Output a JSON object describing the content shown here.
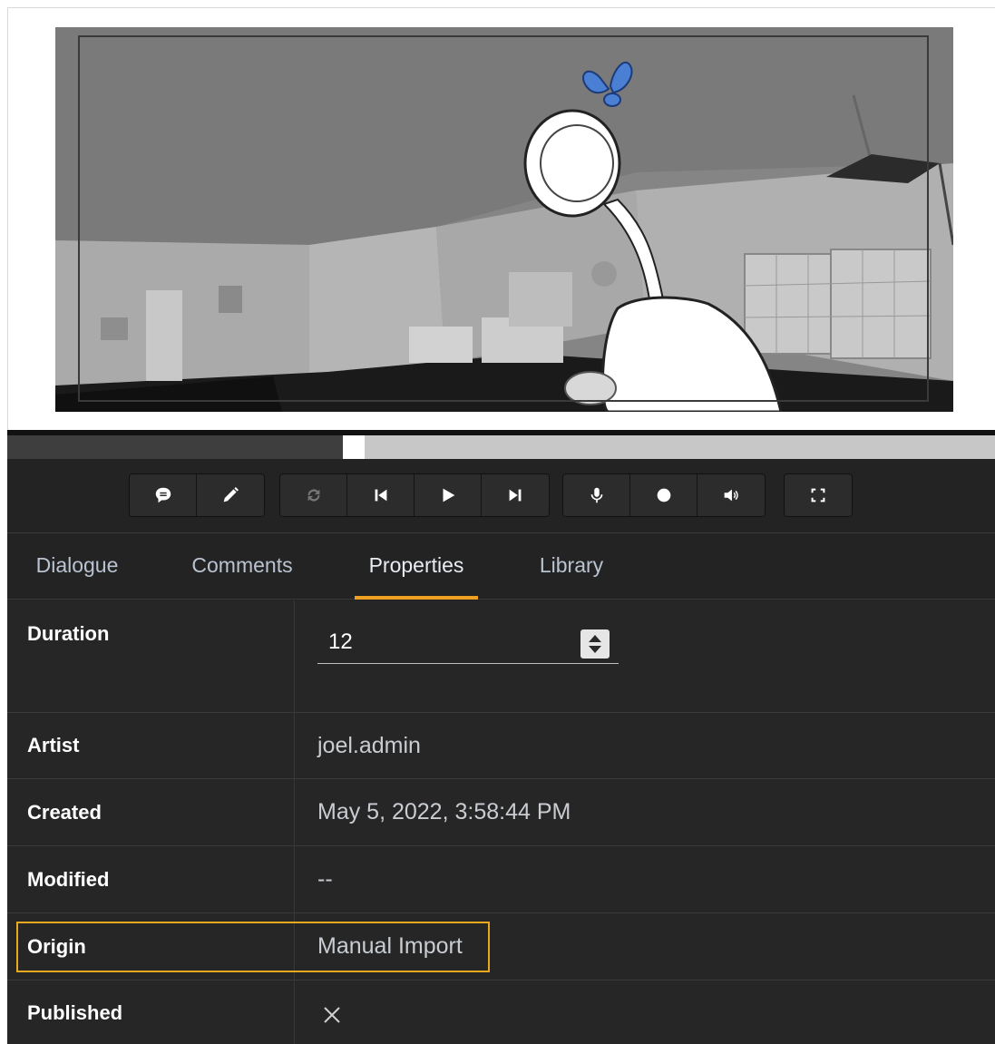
{
  "toolbar": {
    "groups": [
      {
        "buttons": [
          {
            "icon": "comment-icon"
          },
          {
            "icon": "pencil-icon"
          }
        ]
      },
      {
        "buttons": [
          {
            "icon": "loop-icon",
            "disabled": true
          },
          {
            "icon": "skip-back-icon"
          },
          {
            "icon": "play-icon"
          },
          {
            "icon": "skip-forward-icon"
          }
        ]
      },
      {
        "buttons": [
          {
            "icon": "microphone-icon"
          },
          {
            "icon": "record-icon"
          },
          {
            "icon": "volume-icon"
          }
        ]
      },
      {
        "buttons": [
          {
            "icon": "fullscreen-icon"
          }
        ]
      }
    ]
  },
  "scrubber": {
    "played_fraction": 0.34
  },
  "tabs": [
    {
      "label": "Dialogue",
      "active": false
    },
    {
      "label": "Comments",
      "active": false
    },
    {
      "label": "Properties",
      "active": true
    },
    {
      "label": "Library",
      "active": false
    }
  ],
  "accent_color": "#f0a020",
  "highlight_color": "#e8a91e",
  "properties": {
    "duration": {
      "label": "Duration",
      "value": "12"
    },
    "artist": {
      "label": "Artist",
      "value": "joel.admin"
    },
    "created": {
      "label": "Created",
      "value": "May 5, 2022, 3:58:44 PM"
    },
    "modified": {
      "label": "Modified",
      "value": "--"
    },
    "origin": {
      "label": "Origin",
      "value": "Manual Import"
    },
    "published": {
      "label": "Published",
      "icon": "x-mark-icon"
    }
  }
}
